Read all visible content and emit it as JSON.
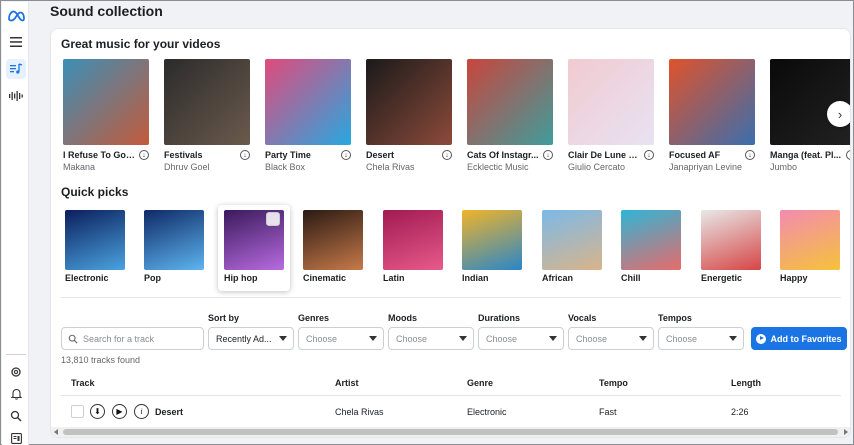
{
  "page": {
    "title": "Sound collection"
  },
  "sidebar": {
    "icons": [
      "meta-logo-icon",
      "menu-icon",
      "music-library-icon",
      "audio-wave-icon",
      "settings-icon",
      "notification-bell-icon",
      "search-icon",
      "help-panel-icon"
    ]
  },
  "featured": {
    "title": "Great music for your videos",
    "albums": [
      {
        "name": "I Refuse To Go ...",
        "artist": "Makana",
        "colors": [
          "#3b8fb8",
          "#c45a3a"
        ]
      },
      {
        "name": "Festivals",
        "artist": "Dhruv Goel",
        "colors": [
          "#2b2b2b",
          "#6b5a4d"
        ]
      },
      {
        "name": "Party Time",
        "artist": "Black Box",
        "colors": [
          "#e14a7c",
          "#27a8e0"
        ]
      },
      {
        "name": "Desert",
        "artist": "Chela Rivas",
        "colors": [
          "#1a1a1a",
          "#8c4a3a"
        ]
      },
      {
        "name": "Cats Of Instagr...",
        "artist": "Ecklectic Music",
        "colors": [
          "#c9453d",
          "#3f9d9c"
        ]
      },
      {
        "name": "Clair De Lune L...",
        "artist": "Giulio Cercato",
        "colors": [
          "#f1cbd0",
          "#e8e2f3"
        ]
      },
      {
        "name": "Focused AF",
        "artist": "Janapriyan Levine",
        "colors": [
          "#e0522a",
          "#3a6fae"
        ]
      },
      {
        "name": "Manga (feat. Pl...",
        "artist": "Jumbo",
        "colors": [
          "#0a0a0a",
          "#222222"
        ]
      }
    ]
  },
  "quick_picks": {
    "title": "Quick picks",
    "items": [
      {
        "label": "Electronic",
        "colors": [
          "#0b1f5c",
          "#4aa3e0"
        ]
      },
      {
        "label": "Pop",
        "colors": [
          "#0f2a66",
          "#5db5f0"
        ]
      },
      {
        "label": "Hip hop",
        "colors": [
          "#3a1a5c",
          "#b86be0"
        ],
        "selected": true
      },
      {
        "label": "Cinematic",
        "colors": [
          "#2b1a12",
          "#c77a4a"
        ]
      },
      {
        "label": "Latin",
        "colors": [
          "#a01a52",
          "#e85a8a"
        ]
      },
      {
        "label": "Indian",
        "colors": [
          "#f0b429",
          "#2a86c9"
        ]
      },
      {
        "label": "African",
        "colors": [
          "#7cb9e8",
          "#d9b48a"
        ]
      },
      {
        "label": "Chill",
        "colors": [
          "#2fb5d6",
          "#e86b6b"
        ]
      },
      {
        "label": "Energetic",
        "colors": [
          "#e8e8e8",
          "#d64545"
        ]
      },
      {
        "label": "Happy",
        "colors": [
          "#f38bb0",
          "#f5c23b"
        ]
      }
    ]
  },
  "filters": {
    "search_placeholder": "Search for a track",
    "sort_label": "Sort by",
    "sort_value": "Recently Ad...",
    "genres_label": "Genres",
    "moods_label": "Moods",
    "durations_label": "Durations",
    "vocals_label": "Vocals",
    "tempos_label": "Tempos",
    "choose": "Choose",
    "add_favorites": "Add to Favorites",
    "tracks_found": "13,810 tracks found"
  },
  "table": {
    "headers": {
      "track": "Track",
      "artist": "Artist",
      "genre": "Genre",
      "tempo": "Tempo",
      "length": "Length"
    },
    "rows": [
      {
        "track": "Desert",
        "artist": "Chela Rivas",
        "genre": "Electronic",
        "tempo": "Fast",
        "length": "2:26"
      }
    ]
  },
  "colors": {
    "accent": "#1b74e4"
  }
}
